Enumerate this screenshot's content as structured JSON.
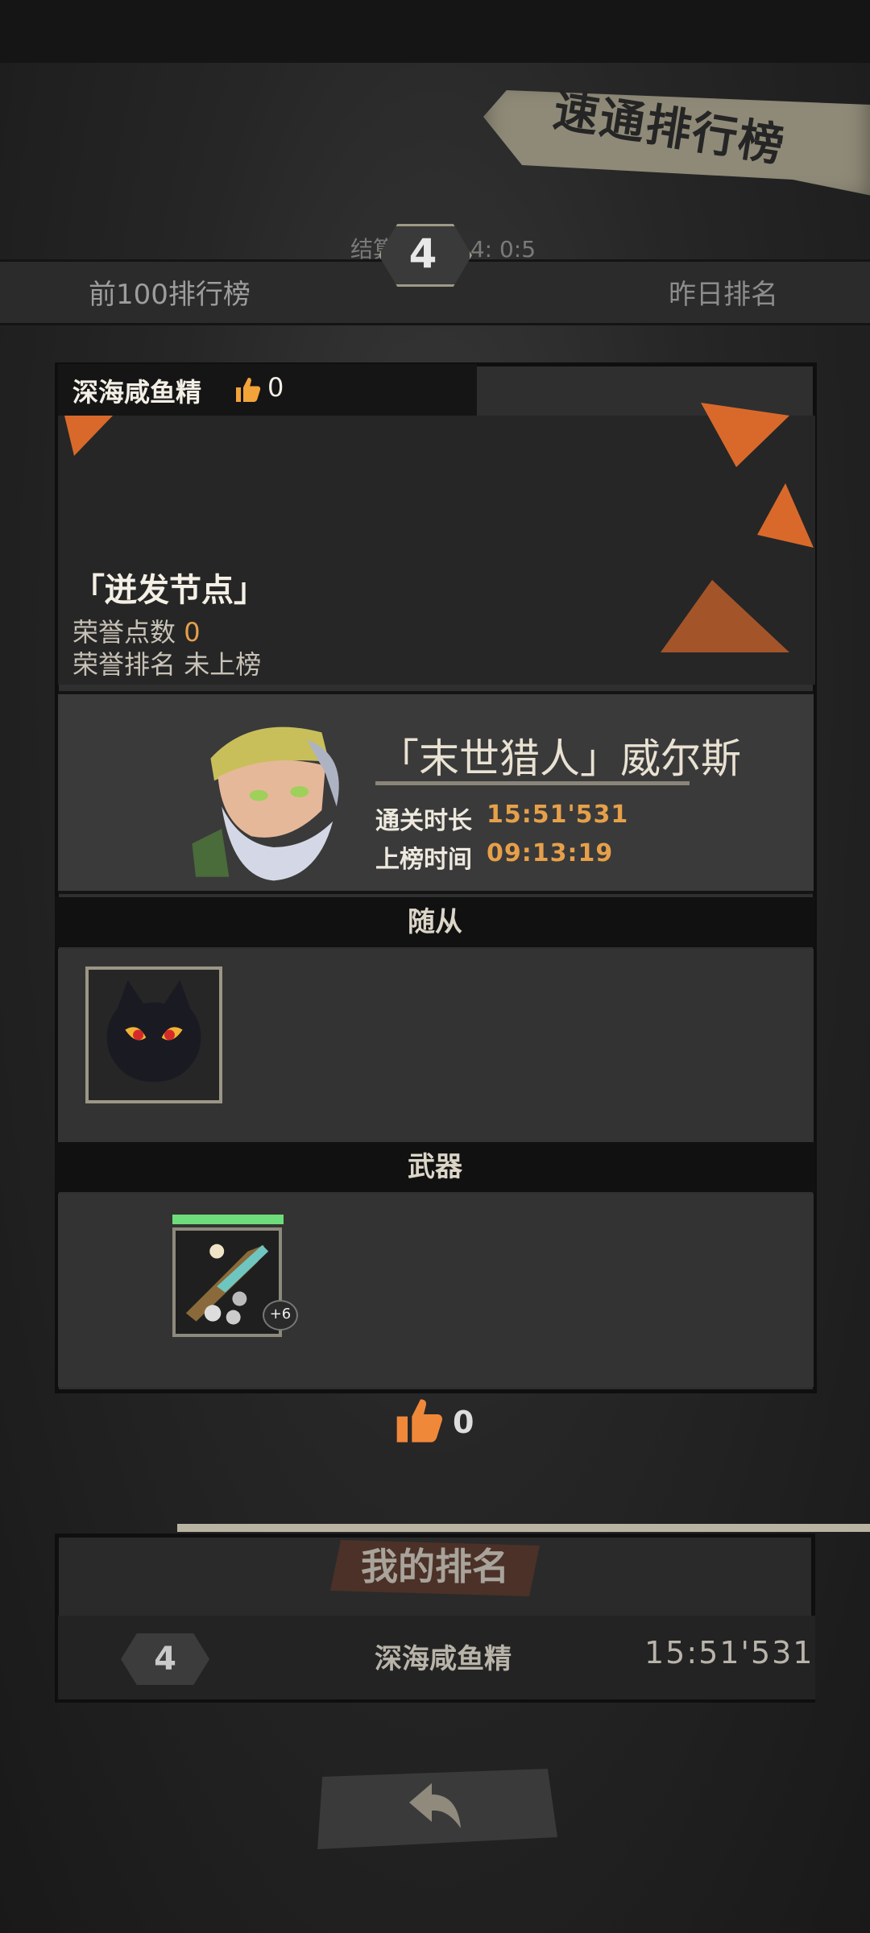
{
  "header": {
    "title": "速通排行榜",
    "tab_left": "前100排行榜",
    "tab_right": "昨日排名",
    "countdown": "结算倒计时 4: 0:5",
    "current_rank": "4"
  },
  "player": {
    "name": "深海咸鱼精",
    "likes": "0"
  },
  "node": {
    "title": "「迸发节点」",
    "honor_points_label": "荣誉点数",
    "honor_points_value": "0",
    "honor_rank_label": "荣誉排名",
    "honor_rank_value": "未上榜"
  },
  "hero": {
    "name": "「末世猎人」威尔斯",
    "clear_time_label": "通关时长",
    "clear_time_value": "15:51'531",
    "listed_time_label": "上榜时间",
    "listed_time_value": "09:13:19"
  },
  "sections": {
    "companion_label": "随从",
    "weapon_label": "武器",
    "weapon_extra": "+6"
  },
  "likes_total": "0",
  "my_rank": {
    "title": "我的排名",
    "rank": "4",
    "name": "深海咸鱼精",
    "time": "15:51'531"
  },
  "colors": {
    "accent_orange": "#d9692b",
    "gold_text": "#e6a04a",
    "hp_green": "#6edc7a"
  },
  "icons": {
    "thumbs_up": "thumbs-up-icon",
    "back": "back-arrow-icon"
  }
}
